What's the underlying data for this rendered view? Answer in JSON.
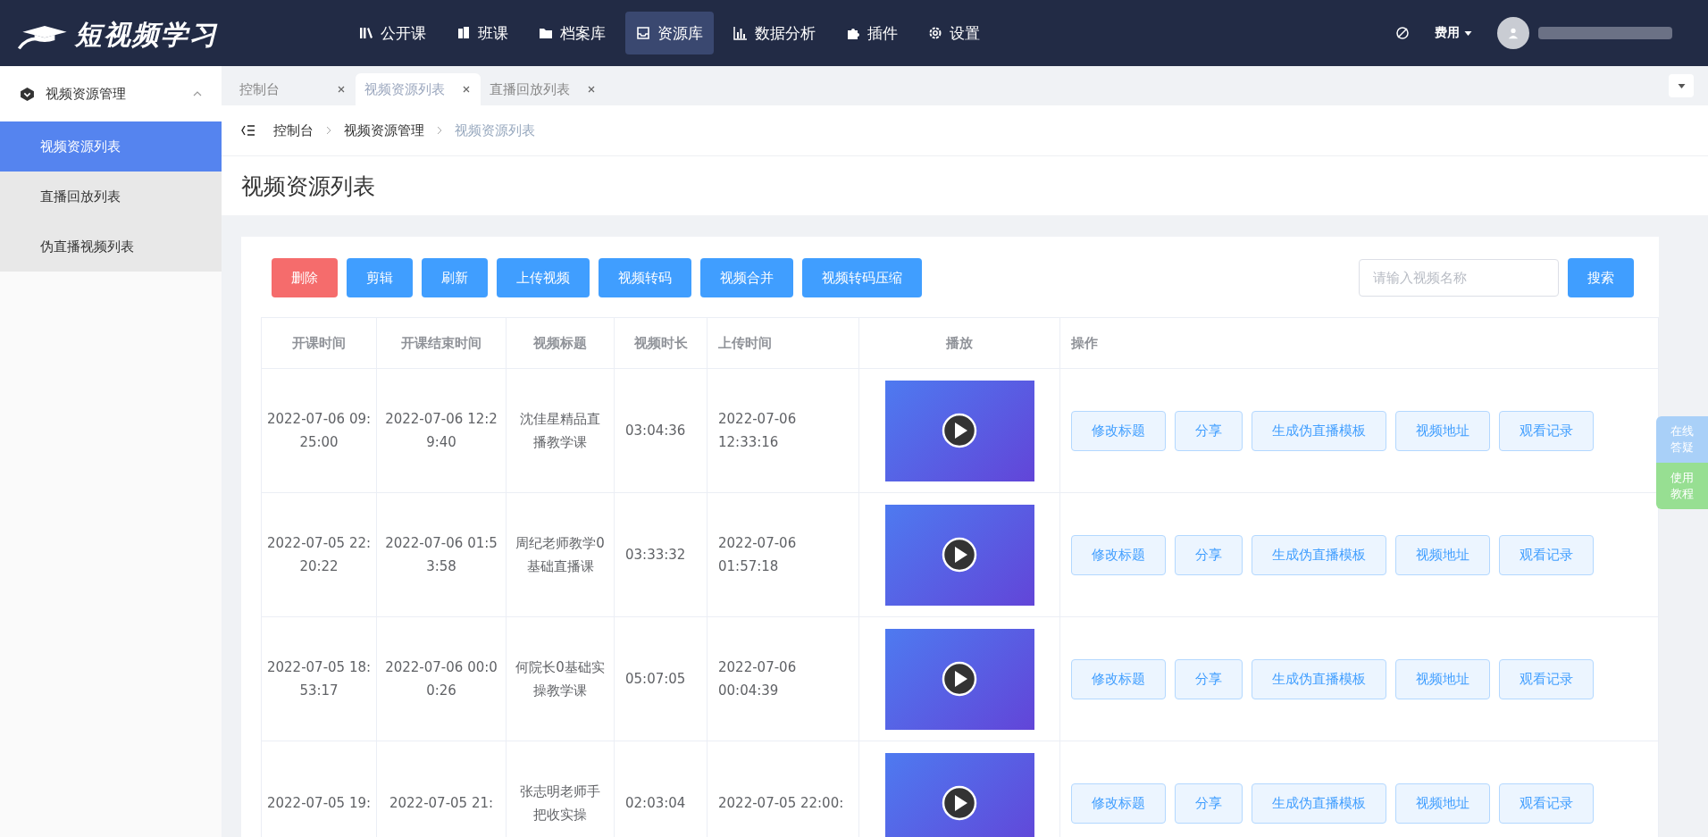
{
  "header": {
    "logo_text": "短视频学习",
    "nav": [
      {
        "label": "公开课",
        "selected": false
      },
      {
        "label": "班课",
        "selected": false
      },
      {
        "label": "档案库",
        "selected": false
      },
      {
        "label": "资源库",
        "selected": true
      },
      {
        "label": "数据分析",
        "selected": false
      },
      {
        "label": "插件",
        "selected": false
      },
      {
        "label": "设置",
        "selected": false
      }
    ],
    "fee_menu": "费用"
  },
  "sidebar": {
    "group": {
      "label": "视频资源管理",
      "expanded": true
    },
    "items": [
      {
        "label": "视频资源列表",
        "selected": true
      },
      {
        "label": "直播回放列表",
        "selected": false
      },
      {
        "label": "伪直播视频列表",
        "selected": false
      }
    ]
  },
  "tabs": [
    {
      "label": "控制台",
      "selected": false
    },
    {
      "label": "视频资源列表",
      "selected": true
    },
    {
      "label": "直播回放列表",
      "selected": false
    }
  ],
  "breadcrumb": [
    "控制台",
    "视频资源管理",
    "视频资源列表"
  ],
  "page_title": "视频资源列表",
  "toolbar": {
    "buttons": [
      {
        "label": "删除",
        "kind": "danger"
      },
      {
        "label": "剪辑",
        "kind": "primary"
      },
      {
        "label": "刷新",
        "kind": "primary"
      },
      {
        "label": "上传视频",
        "kind": "primary"
      },
      {
        "label": "视频转码",
        "kind": "primary"
      },
      {
        "label": "视频合并",
        "kind": "primary"
      },
      {
        "label": "视频转码压缩",
        "kind": "primary"
      }
    ],
    "search": {
      "placeholder": "请输入视频名称"
    },
    "search_button": "搜索"
  },
  "table": {
    "columns": [
      "开课时间",
      "开课结束时间",
      "视频标题",
      "视频时长",
      "上传时间",
      "播放",
      "操作"
    ],
    "rows": [
      {
        "start": "2022-07-06 09:25:00",
        "end": "2022-07-06 12:29:40",
        "title": "沈佳星精品直播教学课",
        "duration": "03:04:36",
        "uploaded": "2022-07-06 12:33:16",
        "actions": [
          "修改标题",
          "分享",
          "生成伪直播模板",
          "视频地址",
          "观看记录"
        ]
      },
      {
        "start": "2022-07-05 22:20:22",
        "end": "2022-07-06 01:53:58",
        "title": "周纪老师教学0基础直播课",
        "duration": "03:33:32",
        "uploaded": "2022-07-06 01:57:18",
        "actions": [
          "修改标题",
          "分享",
          "生成伪直播模板",
          "视频地址",
          "观看记录"
        ]
      },
      {
        "start": "2022-07-05 18:53:17",
        "end": "2022-07-06 00:00:26",
        "title": "何院长0基础实操教学课",
        "duration": "05:07:05",
        "uploaded": "2022-07-06 00:04:39",
        "actions": [
          "修改标题",
          "分享",
          "生成伪直播模板",
          "视频地址",
          "观看记录"
        ]
      },
      {
        "start": "2022-07-05 19:",
        "end": "2022-07-05 21:",
        "title": "张志明老师手把收实操",
        "duration": "02:03:04",
        "uploaded": "2022-07-05 22:00:",
        "actions": [
          "修改标题",
          "分享",
          "生成伪直播模板",
          "视频地址",
          "观看记录"
        ]
      }
    ]
  },
  "float_buttons": [
    {
      "label": "在线答疑",
      "color": "#a9d0f8"
    },
    {
      "label": "使用教程",
      "color": "#97df92"
    }
  ]
}
